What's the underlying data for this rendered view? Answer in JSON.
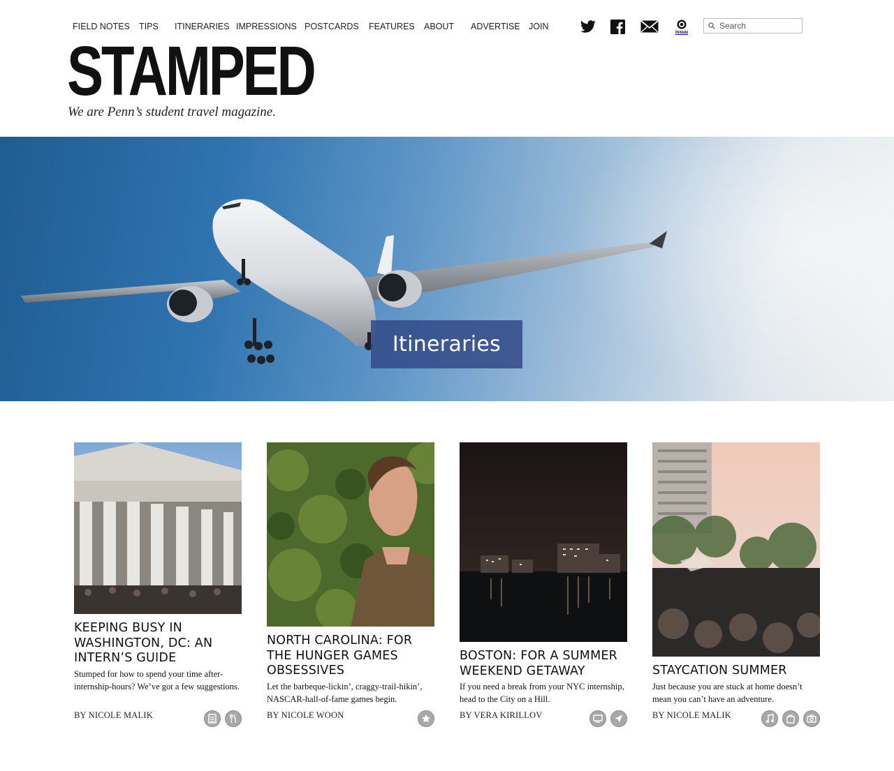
{
  "nav": {
    "items": [
      "FIELD NOTES",
      "TIPS",
      "ITINERARIES",
      "IMPRESSIONS",
      "POSTCARDS",
      "FEATURES",
      "ABOUT",
      "ADVERTISE",
      "JOIN"
    ],
    "social_icons": [
      "twitter-icon",
      "facebook-icon",
      "mail-icon",
      "issuu-icon"
    ],
    "issuu_label": "issuu",
    "search_placeholder": "Search"
  },
  "brand": {
    "logo": "STAMPED",
    "tagline": "We are Penn’s student travel magazine."
  },
  "hero": {
    "label": "Itineraries"
  },
  "articles": [
    {
      "title": "KEEPING BUSY IN WASHINGTON, DC: AN INTERN’S GUIDE",
      "description": "Stumped for how to spend your time after-internship-hours? We’ve got a few suggestions.",
      "byline": "BY NICOLE MALIK",
      "icons": [
        "notepad-icon",
        "fork-knife-icon"
      ]
    },
    {
      "title": "NORTH CAROLINA: FOR THE HUNGER GAMES OBSESSIVES",
      "description": "Let the barbeque-lickin’, craggy-trail-hikin’, NASCAR-hall-of-fame games begin.",
      "byline": "BY NICOLE WOON",
      "icons": [
        "star-icon"
      ]
    },
    {
      "title": "BOSTON: FOR A SUMMER WEEKEND GETAWAY",
      "description": "If you need a break from your NYC internship, head to the City on a Hill.",
      "byline": "BY VERA KIRILLOV",
      "icons": [
        "tv-icon",
        "airplane-icon"
      ]
    },
    {
      "title": "STAYCATION SUMMER",
      "description": "Just because you are stuck at home doesn’t mean you can’t have an adventure.",
      "byline": "BY NICOLE MALIK",
      "icons": [
        "music-note-icon",
        "suitcase-icon",
        "camera-icon"
      ]
    }
  ]
}
